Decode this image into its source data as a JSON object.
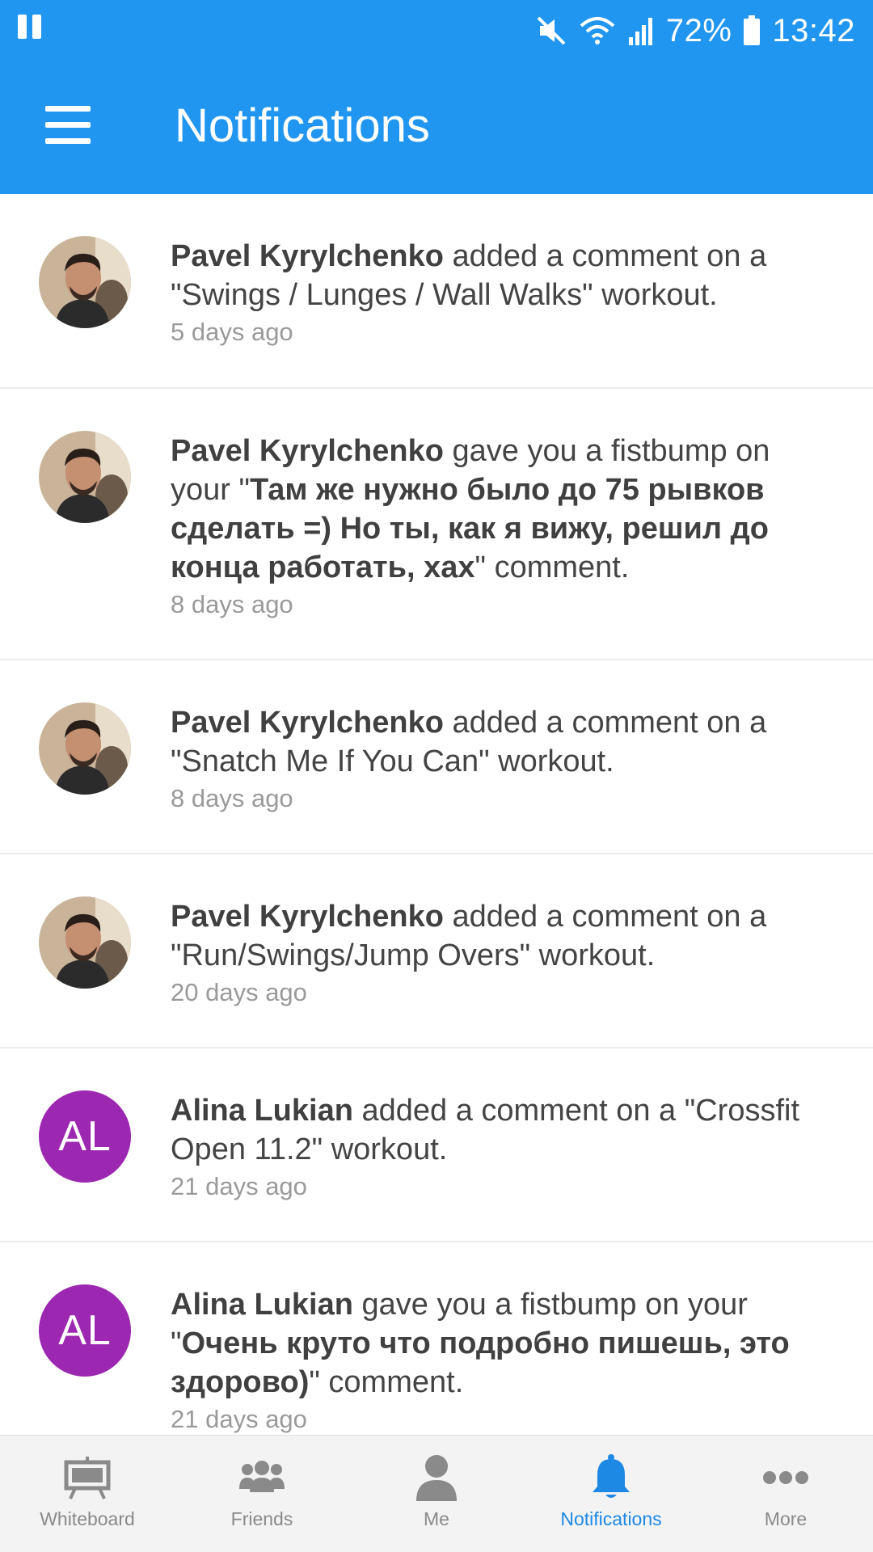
{
  "status_bar": {
    "battery": "72%",
    "time": "13:42"
  },
  "app_bar": {
    "title": "Notifications"
  },
  "notifications": [
    {
      "actor": "Pavel Kyrylchenko",
      "action": " added a comment on a \"Swings / Lunges / Wall Walks\" workout.",
      "quote": "",
      "suffix": "",
      "time": "5 days ago",
      "avatar": "photo"
    },
    {
      "actor": "Pavel Kyrylchenko",
      "action": " gave you a fistbump on your \"",
      "quote": "Там же нужно было до 75 рывков сделать =) Но ты, как я вижу, решил до конца работать, хах",
      "suffix": "\" comment.",
      "time": "8 days ago",
      "avatar": "photo"
    },
    {
      "actor": "Pavel Kyrylchenko",
      "action": " added a comment on a \"Snatch Me If You Can\" workout.",
      "quote": "",
      "suffix": "",
      "time": "8 days ago",
      "avatar": "photo"
    },
    {
      "actor": "Pavel Kyrylchenko",
      "action": " added a comment on a \"Run/Swings/Jump Overs\" workout.",
      "quote": "",
      "suffix": "",
      "time": "20 days ago",
      "avatar": "photo"
    },
    {
      "actor": "Alina Lukian",
      "action": " added a comment on a \"Crossfit Open 11.2\" workout.",
      "quote": "",
      "suffix": "",
      "time": "21 days ago",
      "avatar": "AL"
    },
    {
      "actor": "Alina Lukian",
      "action": " gave you a fistbump on your \"",
      "quote": "Очень круто что подробно пишешь, это здорово)",
      "suffix": "\" comment.",
      "time": "21 days ago",
      "avatar": "AL"
    }
  ],
  "bottom_nav": {
    "items": [
      {
        "label": "Whiteboard",
        "icon": "whiteboard-icon",
        "active": false
      },
      {
        "label": "Friends",
        "icon": "friends-icon",
        "active": false
      },
      {
        "label": "Me",
        "icon": "person-icon",
        "active": false
      },
      {
        "label": "Notifications",
        "icon": "bell-icon",
        "active": true
      },
      {
        "label": "More",
        "icon": "more-dots-icon",
        "active": false
      }
    ]
  },
  "colors": {
    "primary": "#2196f0",
    "active_nav": "#1e88e5",
    "avatar_initials_bg": "#9c27b0",
    "text_primary": "#444444",
    "text_secondary": "#9a9a9a"
  }
}
